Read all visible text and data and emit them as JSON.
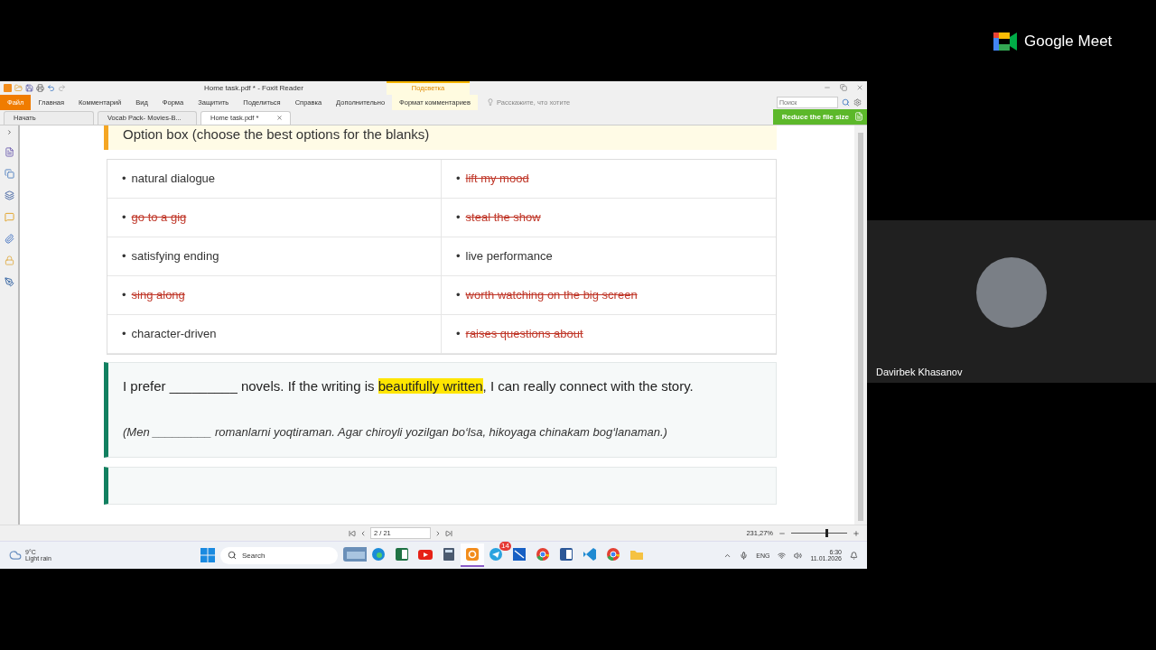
{
  "meet": {
    "brand": "Google Meet",
    "participant": "Davirbek Khasanov"
  },
  "app": {
    "title": "Home task.pdf * - Foxit Reader",
    "context_tab": "Подсветка",
    "menu": [
      {
        "label": "Файл",
        "selected": true,
        "contextual": false
      },
      {
        "label": "Главная",
        "selected": false,
        "contextual": false
      },
      {
        "label": "Комментарий",
        "selected": false,
        "contextual": false
      },
      {
        "label": "Вид",
        "selected": false,
        "contextual": false
      },
      {
        "label": "Форма",
        "selected": false,
        "contextual": false
      },
      {
        "label": "Защитить",
        "selected": false,
        "contextual": false
      },
      {
        "label": "Поделиться",
        "selected": false,
        "contextual": false
      },
      {
        "label": "Справка",
        "selected": false,
        "contextual": false
      },
      {
        "label": "Дополнительно",
        "selected": false,
        "contextual": false
      },
      {
        "label": "Формат комментариев",
        "selected": false,
        "contextual": true
      }
    ],
    "tell_me": "Расскажите, что хотите",
    "search": {
      "placeholder": "Поиск"
    },
    "promo": "Reduce the file size",
    "doc_tabs": [
      {
        "label": "Начать",
        "selected": false,
        "closable": false
      },
      {
        "label": "Vocab Pack- Movies-B...",
        "selected": false,
        "closable": false
      },
      {
        "label": "Home task.pdf *",
        "selected": true,
        "closable": true
      }
    ]
  },
  "document": {
    "option_box": {
      "title": "Option box (choose the best options for the blanks)",
      "items": [
        {
          "marker": "•",
          "text": "natural dialogue",
          "crossed": false
        },
        {
          "marker": "•",
          "text": "lift my mood",
          "crossed": true
        },
        {
          "marker": "•",
          "text": "go to a gig",
          "crossed": true
        },
        {
          "marker": "•",
          "text": "steal the show",
          "crossed": true
        },
        {
          "marker": "•",
          "text": "satisfying ending",
          "crossed": false
        },
        {
          "marker": "•",
          "text": "live performance",
          "crossed": false
        },
        {
          "marker": "•",
          "text": "sing along",
          "crossed": true
        },
        {
          "marker": "•",
          "text": "worth watching on the big screen",
          "crossed": true
        },
        {
          "marker": "•",
          "text": "character-driven",
          "crossed": false
        },
        {
          "marker": "•",
          "text": "raises questions about",
          "crossed": true
        }
      ]
    },
    "exercise": {
      "sentence": [
        {
          "text": "I prefer _________ novels. If the writing is ",
          "highlighted": false
        },
        {
          "text": "beautifully written",
          "highlighted": true
        },
        {
          "text": ", I can really connect with the story.",
          "highlighted": false
        }
      ],
      "translation": "(Men _________ romanlarni yoqtiraman. Agar chiroyli yozilgan bo‘lsa, hikoyaga chinakam bog‘lanaman.)"
    }
  },
  "status": {
    "page": "2 / 21",
    "zoom": "231,27%",
    "zoom_slider": {
      "level": 0.63
    }
  },
  "taskbar": {
    "weather": {
      "temp": "9°C",
      "desc": "Light rain"
    },
    "search": {
      "placeholder": "Search"
    },
    "apps": [
      {
        "kind": "widgets",
        "active": false
      },
      {
        "kind": "edge",
        "active": false
      },
      {
        "kind": "excel",
        "active": false
      },
      {
        "kind": "youtube",
        "active": false
      },
      {
        "kind": "calculator",
        "active": false
      },
      {
        "kind": "foxit",
        "active": true
      },
      {
        "kind": "telegram",
        "active": false,
        "badge": "14"
      },
      {
        "kind": "snip",
        "active": false
      },
      {
        "kind": "chrome",
        "active": false
      },
      {
        "kind": "word",
        "active": false
      },
      {
        "kind": "vscode",
        "active": false
      },
      {
        "kind": "chrome",
        "active": false
      },
      {
        "kind": "explorer",
        "active": false
      }
    ],
    "lang": "ENG",
    "time": "6:30",
    "date": "11.01.2026"
  }
}
